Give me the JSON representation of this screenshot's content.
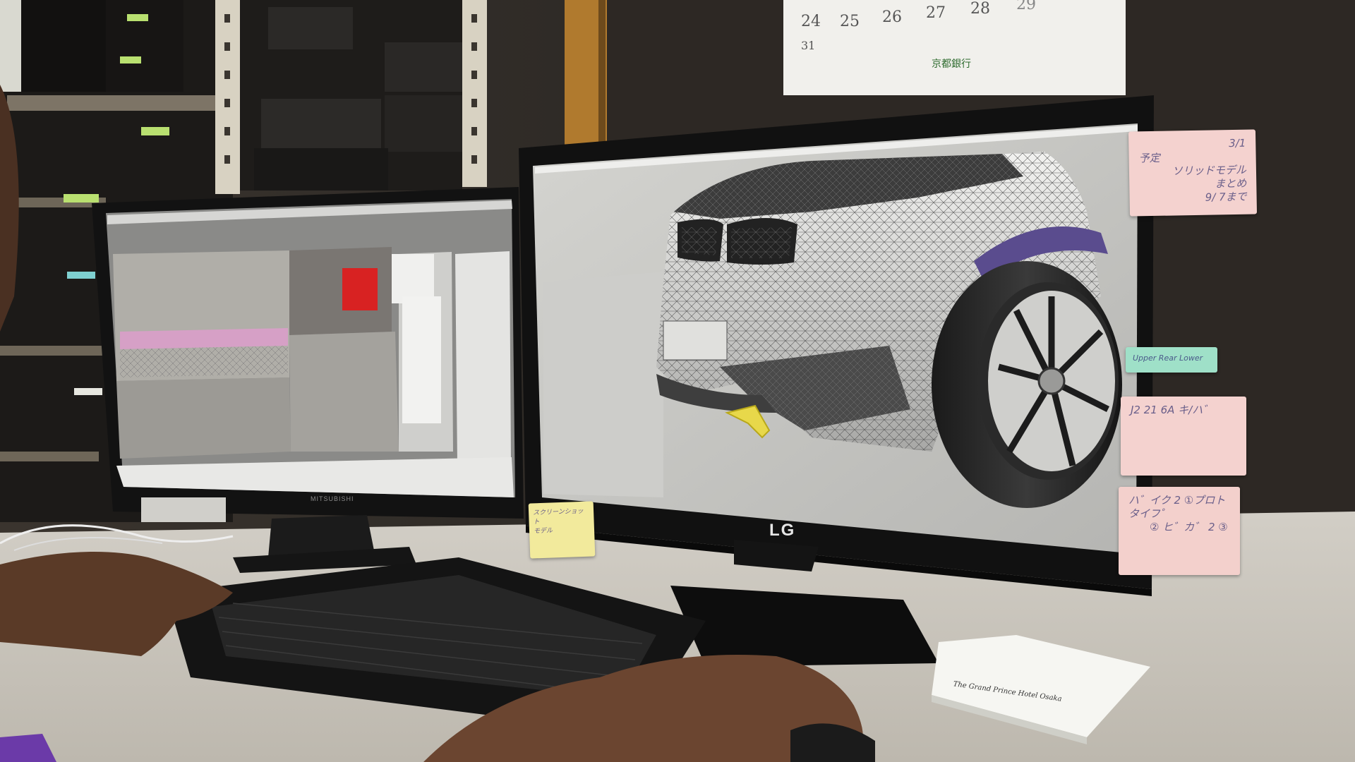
{
  "scene": {
    "description_free": true,
    "calendar": {
      "dates": [
        "24",
        "25",
        "26",
        "27",
        "28",
        "29",
        "31"
      ],
      "bank_name": "京都銀行"
    },
    "left_monitor": {
      "brand": "MITSUBISHI"
    },
    "right_monitor": {
      "brand": "LG"
    },
    "sticky_notes": {
      "top_right": [
        "3/1",
        "予定",
        "ソリッドモデル",
        "まとめ",
        "9/ 7まで"
      ],
      "green_tab": "Upper Rear Lower",
      "middle_right": "J2 21 6A  キ/ハ゛",
      "bottom_right": [
        "ハ゛イク 2 ①プロトタイフ゜",
        "② ヒ゛カ゛ 2 ③"
      ],
      "bezel_note": [
        "スクリーンショット",
        "モデル"
      ]
    },
    "notepad_text": "The Grand Prince Hotel Osaka"
  },
  "colors": {
    "wall": "#2b2724",
    "sticky_pink": "#f4d2cf",
    "sticky_green": "#9fe0c8",
    "sticky_yellow": "#f2ea9c",
    "desk": "#d9d6cf",
    "screen_bg": "#c7c7c4"
  }
}
